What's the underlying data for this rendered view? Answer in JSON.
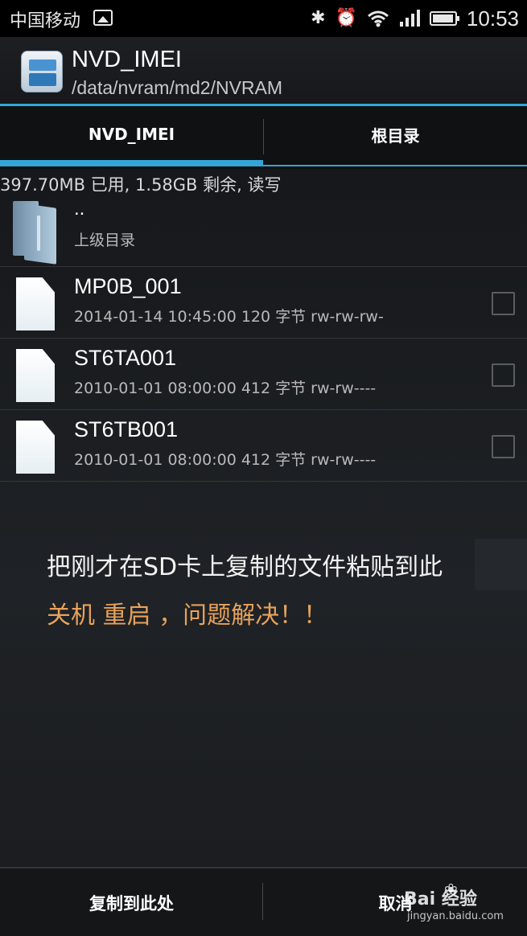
{
  "status_bar": {
    "carrier": "中国移动",
    "time": "10:53",
    "icons": [
      "picture-icon",
      "bluetooth-icon",
      "alarm-icon",
      "wifi-icon",
      "signal-icon",
      "battery-icon"
    ]
  },
  "action_bar": {
    "title": "NVD_IMEI",
    "path": "/data/nvram/md2/NVRAM",
    "accent_color": "#33a5d6"
  },
  "tabs": [
    {
      "label": "NVD_IMEI",
      "active": true
    },
    {
      "label": "根目录",
      "active": false
    }
  ],
  "storage_info": "397.70MB 已用, 1.58GB 剩余, 读写",
  "parent_entry": {
    "name": "..",
    "sub": "上级目录"
  },
  "files": [
    {
      "name": "MP0B_001",
      "meta": "2014-01-14 10:45:00  120 字节  rw-rw-rw-"
    },
    {
      "name": "ST6TA001",
      "meta": "2010-01-01 08:00:00  412 字节  rw-rw----"
    },
    {
      "name": "ST6TB001",
      "meta": "2010-01-01 08:00:00  412 字节  rw-rw----"
    }
  ],
  "overlay": {
    "line1": "把刚才在SD卡上复制的文件粘贴到此",
    "line2": "关机 重启 ，问题解决！！",
    "line2_color": "#e7a25b"
  },
  "bottom_bar": {
    "copy_here": "复制到此处",
    "cancel": "取消"
  },
  "watermark": {
    "brand": "Bai  经验",
    "url": "jingyan.baidu.com"
  }
}
